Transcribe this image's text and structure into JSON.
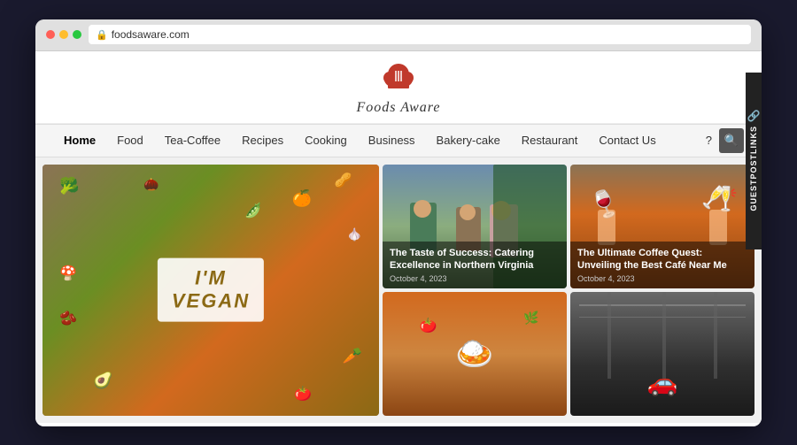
{
  "browser": {
    "url": "foodsaware.com",
    "dots": [
      "red",
      "yellow",
      "green"
    ]
  },
  "site": {
    "logo_text": "Foods Aware",
    "logo_icon": "🍴"
  },
  "nav": {
    "items": [
      {
        "label": "Home",
        "active": true
      },
      {
        "label": "Food",
        "active": false
      },
      {
        "label": "Tea-Coffee",
        "active": false
      },
      {
        "label": "Recipes",
        "active": false
      },
      {
        "label": "Cooking",
        "active": false
      },
      {
        "label": "Business",
        "active": false
      },
      {
        "label": "Bakery-cake",
        "active": false
      },
      {
        "label": "Restaurant",
        "active": false
      },
      {
        "label": "Contact Us",
        "active": false
      }
    ],
    "more_label": "?",
    "search_icon": "🔍"
  },
  "articles": [
    {
      "id": "main",
      "text": "I'M\nVEGAN",
      "tag": "main-feature"
    },
    {
      "id": "catering",
      "title": "The Taste of Success: Catering Excellence in Northern Virginia",
      "date": "October 4, 2023"
    },
    {
      "id": "coffee",
      "title": "The Ultimate Coffee Quest: Unveiling the Best Café Near Me",
      "date": "October 4, 2023"
    },
    {
      "id": "curry",
      "title": "",
      "date": ""
    },
    {
      "id": "car",
      "title": "",
      "date": ""
    }
  ],
  "sidebar": {
    "label": "GUESTPOSTLINKS",
    "icon": "🔗"
  }
}
